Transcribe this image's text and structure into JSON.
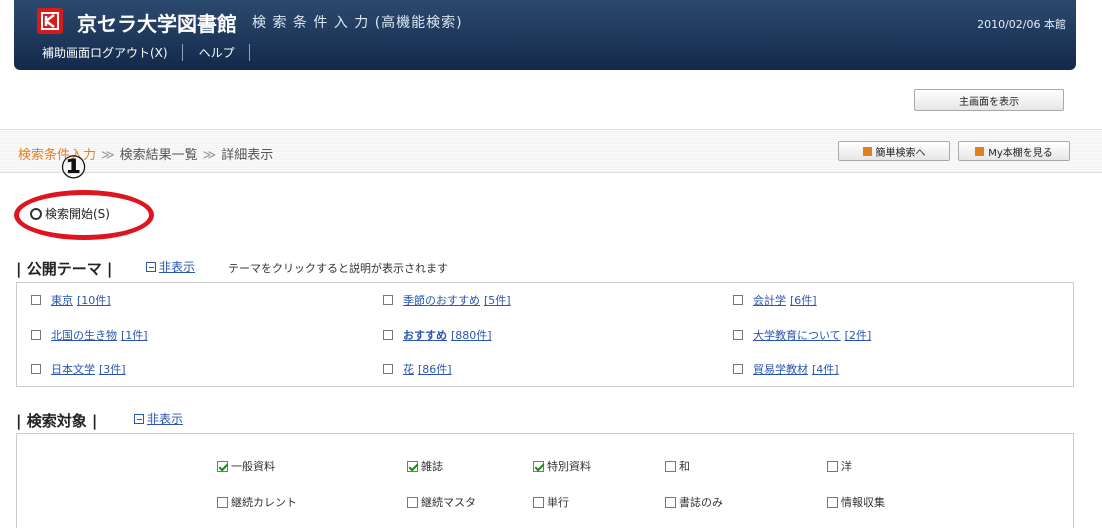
{
  "header": {
    "site_title": "京セラ大学図書館",
    "page_subtitle": "検 索 条 件 入 力 (高機能検索)",
    "date_library": "2010/02/06 本館",
    "nav": [
      "補助画面ログアウト(X)",
      "ヘルプ"
    ]
  },
  "main_screen_button": "主画面を表示",
  "breadcrumb": {
    "current": "検索条件入力",
    "items": [
      "検索結果一覧",
      "詳細表示"
    ],
    "separator": "≫"
  },
  "quick_buttons": {
    "simple_search": "簡単検索へ",
    "my_bookshelf": "My本棚を見る"
  },
  "annotation_marker": "①",
  "search_start": "検索開始(S)",
  "public_themes": {
    "heading": "| 公開テーマ |",
    "toggle": "非表示",
    "hint": "テーマをクリックすると説明が表示されます",
    "items": [
      {
        "name": "東京",
        "count": "[10件]"
      },
      {
        "name": "季節のおすすめ",
        "count": "[5件]"
      },
      {
        "name": "会計学",
        "count": "[6件]"
      },
      {
        "name": "北国の生き物",
        "count": "[1件]"
      },
      {
        "name": "おすすめ",
        "count": "[880件]"
      },
      {
        "name": "大学教育について",
        "count": "[2件]"
      },
      {
        "name": "日本文学",
        "count": "[3件]"
      },
      {
        "name": "花",
        "count": "[86件]"
      },
      {
        "name": "貿易学教材",
        "count": "[4件]"
      }
    ]
  },
  "search_targets": {
    "heading": "| 検索対象 |",
    "toggle": "非表示",
    "items": [
      {
        "label": "一般資料",
        "checked": true
      },
      {
        "label": "雑誌",
        "checked": true
      },
      {
        "label": "特別資料",
        "checked": true
      },
      {
        "label": "和",
        "checked": false
      },
      {
        "label": "洋",
        "checked": false
      },
      {
        "label": "継続カレント",
        "checked": false
      },
      {
        "label": "継続マスタ",
        "checked": false
      },
      {
        "label": "単行",
        "checked": false
      },
      {
        "label": "書誌のみ",
        "checked": false
      },
      {
        "label": "情報収集",
        "checked": false
      }
    ]
  }
}
